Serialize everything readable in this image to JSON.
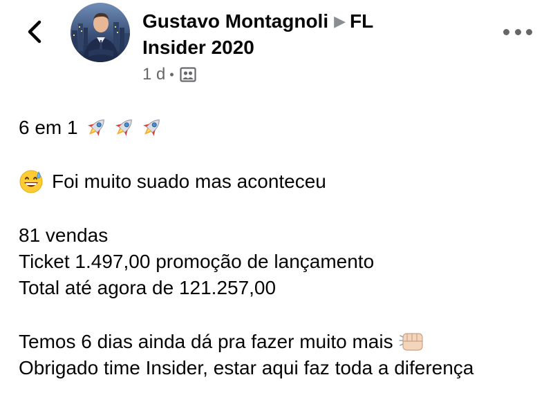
{
  "header": {
    "author": "Gustavo Montagnoli",
    "group": "FL Insider 2020",
    "time": "1 d",
    "privacy_icon": "group-members-icon"
  },
  "icons": {
    "back": "chevron-left-icon",
    "more": "more-options-icon"
  },
  "colors": {
    "text": "#050505",
    "secondary": "#65676b",
    "arrow": "#8a8d91"
  },
  "post": {
    "line1": "6 em 1",
    "line2": "Foi muito suado mas aconteceu",
    "line3": "81 vendas",
    "line4": "Ticket 1.497,00 promoção de lançamento",
    "line5": "Total até agora de 121.257,00",
    "line6": "Temos 6 dias ainda dá pra fazer muito mais",
    "line7": "Obrigado time Insider, estar aqui faz toda a diferença"
  }
}
